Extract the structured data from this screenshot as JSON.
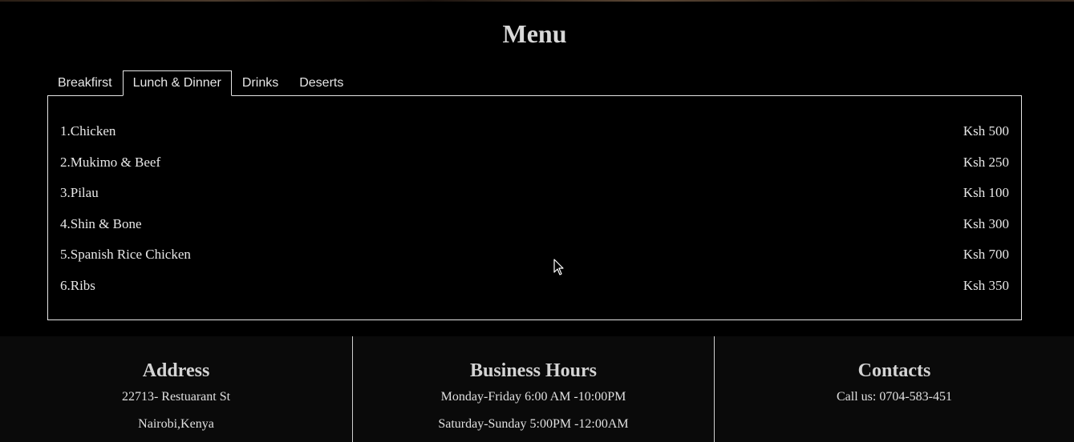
{
  "menu": {
    "title": "Menu",
    "tabs": [
      {
        "label": "Breakfirst",
        "active": false
      },
      {
        "label": "Lunch & Dinner",
        "active": true
      },
      {
        "label": "Drinks",
        "active": false
      },
      {
        "label": "Deserts",
        "active": false
      }
    ],
    "items": [
      {
        "name": "1.Chicken",
        "price": "Ksh 500"
      },
      {
        "name": "2.Mukimo & Beef",
        "price": "Ksh 250"
      },
      {
        "name": "3.Pilau",
        "price": "Ksh 100"
      },
      {
        "name": "4.Shin & Bone",
        "price": "Ksh 300"
      },
      {
        "name": "5.Spanish Rice Chicken",
        "price": "Ksh 700"
      },
      {
        "name": "6.Ribs",
        "price": "Ksh 350"
      }
    ]
  },
  "footer": {
    "address": {
      "heading": "Address",
      "line1": "22713- Restuarant St",
      "line2": "Nairobi,Kenya"
    },
    "hours": {
      "heading": "Business Hours",
      "line1": "Monday-Friday 6:00 AM -10:00PM",
      "line2": "Saturday-Sunday 5:00PM -12:00AM"
    },
    "contacts": {
      "heading": "Contacts",
      "line1": "Call us: 0704-583-451"
    }
  },
  "icons": {
    "cursor": "mouse-pointer-icon"
  }
}
